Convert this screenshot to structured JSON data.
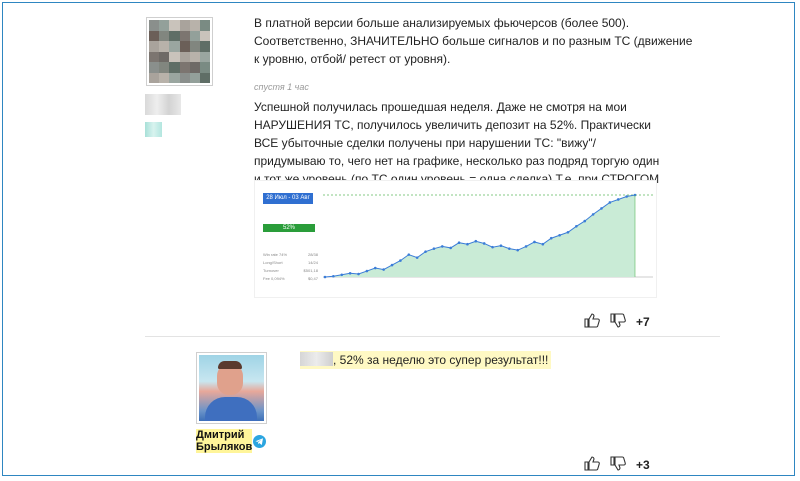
{
  "post1": {
    "text1": "В платной версии больше анализируемых фьючерсов (более 500). Соответственно, ЗНАЧИТЕЛЬНО больше сигналов и по разным ТС (движение к уровню, отбой/ ретест от уровня).",
    "time": "спустя 1 час",
    "text2": "Успешной получилась прошедшая неделя. Даже не смотря на мои НАРУШЕНИЯ ТС, получилось увеличить депозит на 52%. Практически ВСЕ убыточные сделки получены при нарушении ТС: \"вижу\"/ придумываю то, чего нет на графике, несколько раз подряд торгую один и тот же уровень (по ТС один уровень = одна сделка).Т.е. при СТРОГОМ СОБЛЮДЕНИИ ТС результат может быть и выше ). Дело за малым, ... )",
    "likes": "+7"
  },
  "embedded": {
    "dates": "28 Июл - 03 Авг",
    "percent": "52%",
    "stats": [
      {
        "label": "Win rate 74%",
        "value": "28/38"
      },
      {
        "label": "Long/Short",
        "value": "14/24"
      },
      {
        "label": "Turnover",
        "value": "$501,18"
      },
      {
        "label": "Fee 0,094%",
        "value": "$0,47"
      }
    ]
  },
  "chart_data": {
    "type": "area",
    "x": [
      1,
      2,
      3,
      4,
      5,
      6,
      7,
      8,
      9,
      10,
      11,
      12,
      13,
      14,
      15,
      16,
      17,
      18,
      19,
      20,
      21,
      22,
      23,
      24,
      25,
      26,
      27,
      28,
      29,
      30,
      31,
      32,
      33,
      34,
      35,
      36,
      37,
      38
    ],
    "series": [
      {
        "values": [
          0,
          1,
          3,
          5,
          4,
          8,
          12,
          10,
          16,
          22,
          30,
          26,
          34,
          38,
          41,
          39,
          46,
          44,
          48,
          45,
          40,
          42,
          38,
          36,
          41,
          47,
          44,
          52,
          56,
          60,
          68,
          75,
          84,
          92,
          100,
          104,
          108,
          110
        ]
      }
    ],
    "colors": {
      "line": "#3b7dd8",
      "fill": "#c9ebd6",
      "target": "#5cb85c"
    }
  },
  "reply": {
    "text": ", 52% за неделю это супер результат!!!",
    "author_line1": "Дмитрий",
    "author_line2": "Брыляков",
    "likes": "+3"
  },
  "icons": [
    "thumbs-up-icon",
    "thumbs-down-icon",
    "telegram-icon"
  ]
}
